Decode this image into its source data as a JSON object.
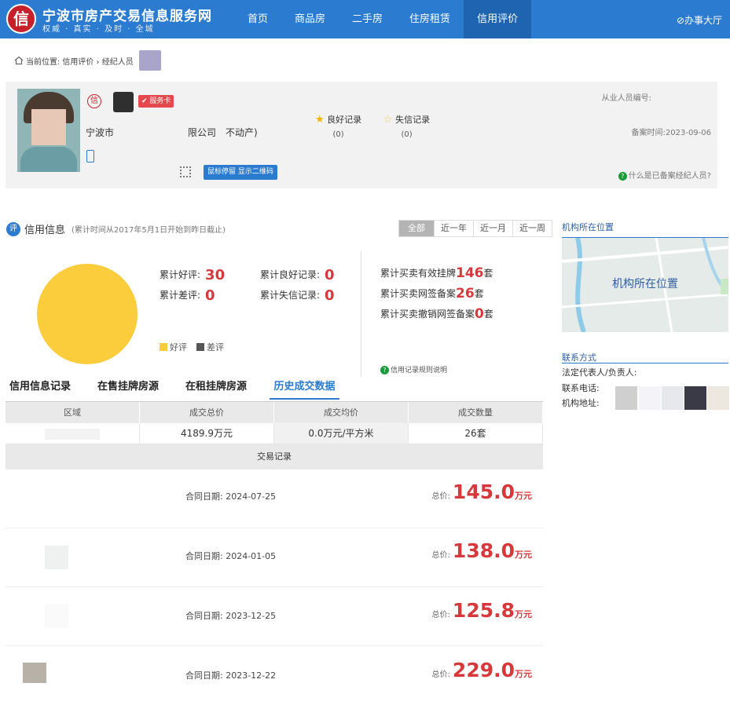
{
  "header": {
    "logo_text": "信",
    "site_title": "宁波市房产交易信息服务网",
    "site_slogan": "权威 · 真实 · 及时 · 全城",
    "nav": [
      "首页",
      "商品房",
      "二手房",
      "住房租赁",
      "信用评价"
    ],
    "active_nav": 4,
    "service_hall": "⊘办事大厅"
  },
  "breadcrumb": {
    "label": "当前位置:",
    "path": "信用评价 › 经纪人员"
  },
  "profile": {
    "credit_badge": "信",
    "service_card": "服务卡",
    "company_prefix": "宁波市",
    "company_mid": "限公司",
    "company_suffix": "不动产)",
    "good_record_label": "良好记录",
    "good_record_count": "(0)",
    "bad_record_label": "失信记录",
    "bad_record_count": "(0)",
    "practitioner_no_label": "从业人员编号:",
    "filing_time": "备案时间:2023-09-06",
    "qr_tip": "鼠标停留 显示二维码",
    "filed_agent_help": "什么是已备案经纪人员?"
  },
  "credit": {
    "icon": "评",
    "title": "信用信息",
    "note": "(累计时间从2017年5月1日开始到昨日截止)",
    "ranges": [
      "全部",
      "近一年",
      "近一月",
      "近一周"
    ],
    "good_reviews_label": "累计好评:",
    "good_reviews": "30",
    "bad_reviews_label": "累计差评:",
    "bad_reviews": "0",
    "good_records_label": "累计良好记录:",
    "good_records": "0",
    "bad_records_label": "累计失信记录:",
    "bad_records": "0",
    "listing_label": "累计买卖有效挂牌",
    "listing_value": "146",
    "signed_label": "累计买卖网签备案",
    "signed_value": "26",
    "cancelled_label": "累计买卖撤销网签备案",
    "cancelled_value": "0",
    "unit": "套",
    "rule_note": "信用记录规则说明",
    "legend_good": "好评",
    "legend_bad": "差评",
    "color_good": "#fbcc3c",
    "color_bad": "#555555"
  },
  "chart_data": {
    "type": "pie",
    "labels": [
      "好评",
      "差评"
    ],
    "values": [
      30,
      0
    ],
    "colors": [
      "#fbcc3c",
      "#555555"
    ]
  },
  "tabs": [
    "信用信息记录",
    "在售挂牌房源",
    "在租挂牌房源",
    "历史成交数据"
  ],
  "active_tab": 3,
  "deal_table": {
    "headers": [
      "区域",
      "成交总价",
      "成交均价",
      "成交数量"
    ],
    "row": [
      "",
      "4189.9万元",
      "0.0万元/平方米",
      "26套"
    ],
    "trade_title": "交易记录"
  },
  "trades": [
    {
      "date_label": "合同日期:",
      "date": "2024-07-25",
      "price_label": "总价:",
      "price": "145.0",
      "unit": "万元",
      "thumb_color": "#ffffff"
    },
    {
      "date_label": "合同日期:",
      "date": "2024-01-05",
      "price_label": "总价:",
      "price": "138.0",
      "unit": "万元",
      "thumb_color": "#eef1ef"
    },
    {
      "date_label": "合同日期:",
      "date": "2023-12-25",
      "price_label": "总价:",
      "price": "125.8",
      "unit": "万元",
      "thumb_color": "#fafafa"
    },
    {
      "date_label": "合同日期:",
      "date": "2023-12-22",
      "price_label": "总价:",
      "price": "229.0",
      "unit": "万元",
      "thumb_color": "#b8b1a8"
    }
  ],
  "sidebar": {
    "location_title": "机构所在位置",
    "map_label": "机构所在位置",
    "contact_title": "联系方式",
    "legal_rep": "法定代表人/负责人:",
    "phone": "联系电话:",
    "address": "机构地址:"
  }
}
